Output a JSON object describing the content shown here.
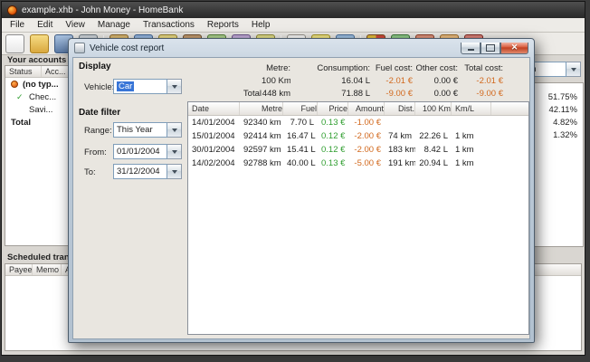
{
  "colors": {
    "positive": "#2f9e2f",
    "negative": "#d2691e",
    "selection": "#3875d7"
  },
  "main_window": {
    "title": "example.xhb - John Money - HomeBank",
    "menu": [
      "File",
      "Edit",
      "View",
      "Manage",
      "Transactions",
      "Reports",
      "Help"
    ],
    "toolbar_icons": [
      "new-file",
      "open-file",
      "save-file",
      "revert",
      "manage-accounts",
      "manage-payees",
      "manage-categories",
      "manage-archives",
      "manage-budget",
      "manage-assignments",
      "manage-currencies",
      "show-transactions",
      "add-transaction",
      "scheduled-transactions",
      "statistics-report",
      "trendtime-report",
      "balance-report",
      "budget-report",
      "vehicle-cost-report"
    ],
    "accounts_panel": {
      "title": "Your accounts",
      "columns": [
        "Status",
        "Acc..."
      ],
      "rows": [
        {
          "label": "(no typ..."
        },
        {
          "label": "Chec..."
        },
        {
          "label": "Savi..."
        },
        {
          "label": "Total"
        }
      ]
    },
    "spending_panel": {
      "period": "Month",
      "percents": [
        "51.75%",
        "42.11%",
        "4.82%",
        "1.32%"
      ]
    },
    "scheduled_panel": {
      "title": "Scheduled transac",
      "columns": [
        "Payee",
        "Memo",
        "Amo..."
      ]
    }
  },
  "dialog": {
    "title": "Vehicle cost report",
    "display": {
      "heading": "Display",
      "vehicle_label": "Vehicle:",
      "vehicle_value": "Car"
    },
    "date_filter": {
      "heading": "Date filter",
      "range_label": "Range:",
      "range_value": "This Year",
      "from_label": "From:",
      "from_value": "01/01/2004",
      "to_label": "To:",
      "to_value": "31/12/2004"
    },
    "summary": {
      "headers": [
        "Metre:",
        "Consumption:",
        "Fuel cost:",
        "Other cost:",
        "Total cost:"
      ],
      "rows": [
        [
          "",
          "100 Km",
          "16.04 L",
          "-2.01 €",
          "0.00 €",
          "-2.01 €"
        ],
        [
          "Total",
          "448 km",
          "71.88 L",
          "-9.00 €",
          "0.00 €",
          "-9.00 €"
        ]
      ]
    },
    "table": {
      "columns": [
        "Date",
        "Metre",
        "Fuel",
        "Price",
        "Amount",
        "Dist.",
        "100 Km",
        "Km/L"
      ],
      "rows": [
        [
          "14/01/2004",
          "92340 km",
          "7.70 L",
          "0.13 €",
          "-1.00 €",
          "",
          "",
          ""
        ],
        [
          "15/01/2004",
          "92414 km",
          "16.47 L",
          "0.12 €",
          "-2.00 €",
          "74 km",
          "22.26 L",
          "1 km"
        ],
        [
          "30/01/2004",
          "92597 km",
          "15.41 L",
          "0.12 €",
          "-2.00 €",
          "183 km",
          "8.42 L",
          "1 km"
        ],
        [
          "14/02/2004",
          "92788 km",
          "40.00 L",
          "0.13 €",
          "-5.00 €",
          "191 km",
          "20.94 L",
          "1 km"
        ]
      ]
    }
  }
}
